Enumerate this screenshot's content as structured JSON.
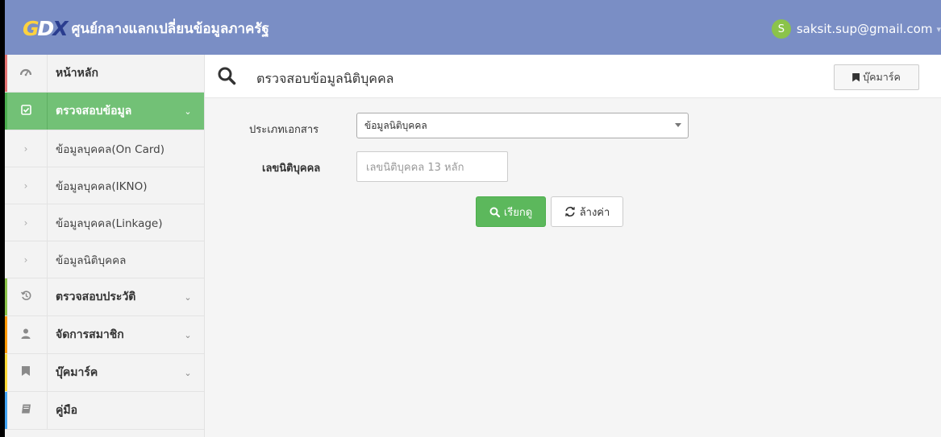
{
  "header": {
    "logo_text": "ศูนย์กลางแลกเปลี่ยนข้อมูลภาครัฐ",
    "logo_mark": {
      "g": "G",
      "d": "D",
      "x": "X"
    },
    "user_initial": "S",
    "user_email": "saksit.sup@gmail.com",
    "user_caret": "▾"
  },
  "sidebar": {
    "items": [
      {
        "label": "หน้าหลัก",
        "icon": "dashboard-icon",
        "accent": "#e57373"
      },
      {
        "label": "ตรวจสอบข้อมูล",
        "icon": "check-square-icon",
        "chevron": "⌄",
        "accent": "#4caf50"
      },
      {
        "label": "ข้อมูลบุคคล(On Card)",
        "icon": "chevron-right-icon",
        "glyph": "›"
      },
      {
        "label": "ข้อมูลบุคคล(IKNO)",
        "icon": "chevron-right-icon",
        "glyph": "›"
      },
      {
        "label": "ข้อมูลบุคคล(Linkage)",
        "icon": "chevron-right-icon",
        "glyph": "›"
      },
      {
        "label": "ข้อมูลนิติบุคคล",
        "icon": "chevron-right-icon",
        "glyph": "›"
      },
      {
        "label": "ตรวจสอบประวัติ",
        "icon": "history-icon",
        "chevron": "⌄",
        "accent": "#8bc34a"
      },
      {
        "label": "จัดการสมาชิก",
        "icon": "user-icon",
        "chevron": "⌄",
        "accent": "#ff9800"
      },
      {
        "label": "บุ๊คมาร์ค",
        "icon": "bookmark-icon",
        "chevron": "⌄",
        "accent": "#fdd835"
      },
      {
        "label": "คู่มือ",
        "icon": "book-icon",
        "accent": "#42a5f5"
      }
    ]
  },
  "main": {
    "title": "ตรวจสอบข้อมูลนิติบุคคล",
    "bookmark_label": "บุ๊คมาร์ค",
    "form": {
      "doc_type_label": "ประเภทเอกสาร",
      "doc_type_value": "ข้อมูลนิติบุคคล",
      "id_label": "เลขนิติบุคคล",
      "id_placeholder": "เลขนิติบุคคล 13 หลัก"
    },
    "search_button": "เรียกดู",
    "clear_button": "ล้างค่า"
  },
  "colors": {
    "topbar": "#7a8ec5",
    "active": "#72c176",
    "search_button": "#5cb85c"
  }
}
